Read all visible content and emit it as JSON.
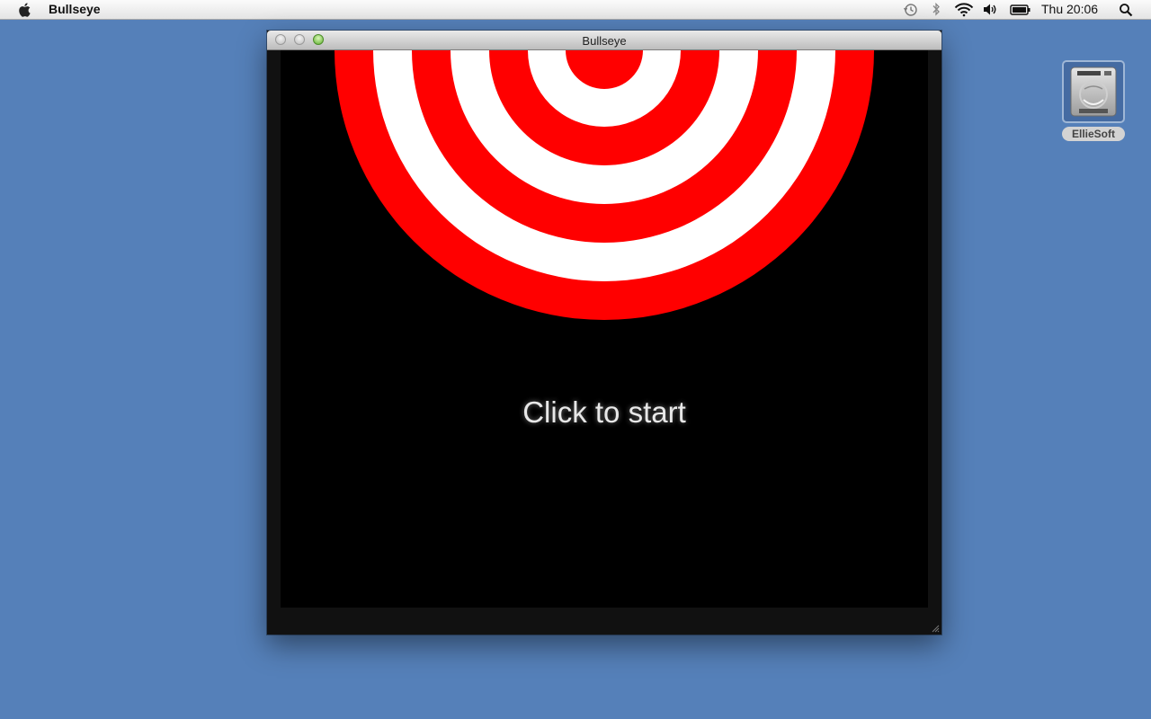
{
  "menubar": {
    "app_name": "Bullseye",
    "clock": "Thu 20:06",
    "status_icons": [
      "apple-logo-icon",
      "time-machine-icon",
      "bluetooth-icon",
      "wifi-icon",
      "volume-icon",
      "battery-icon",
      "spotlight-search-icon"
    ]
  },
  "window": {
    "title": "Bullseye",
    "start_text": "Click to start",
    "target_colors": {
      "red": "#ff0000",
      "white": "#ffffff"
    },
    "background": "#000000"
  },
  "desktop": {
    "background": "#5580b9",
    "drive_label": "EllieSoft"
  }
}
